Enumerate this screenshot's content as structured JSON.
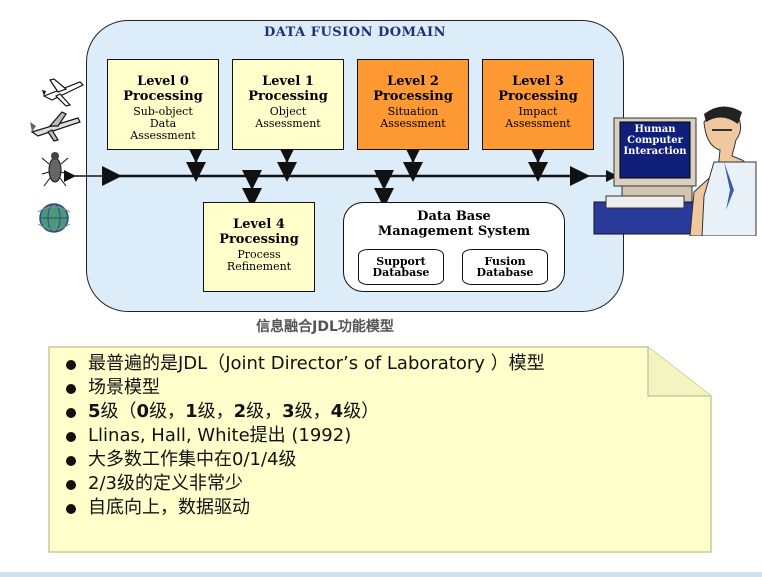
{
  "diagram": {
    "domain_title": "DATA FUSION DOMAIN",
    "level0": {
      "title1": "Level 0",
      "title2": "Processing",
      "sub1": "Sub-object",
      "sub2": "Data",
      "sub3": "Assessment"
    },
    "level1": {
      "title1": "Level 1",
      "title2": "Processing",
      "sub1": "Object",
      "sub2": "Assessment"
    },
    "level2": {
      "title1": "Level 2",
      "title2": "Processing",
      "sub1": "Situation",
      "sub2": "Assessment"
    },
    "level3": {
      "title1": "Level 3",
      "title2": "Processing",
      "sub1": "Impact",
      "sub2": "Assessment"
    },
    "level4": {
      "title1": "Level 4",
      "title2": "Processing",
      "sub1": "Process",
      "sub2": "Refinement"
    },
    "dbms": {
      "title1": "Data Base",
      "title2": "Management System",
      "support1": "Support",
      "support2": "Database",
      "fusion1": "Fusion",
      "fusion2": "Database"
    },
    "hci": {
      "line1": "Human",
      "line2": "Computer",
      "line3": "Interaction"
    },
    "caption": "信息融合JDL功能模型",
    "colors": {
      "domain_bg": "#dcecf8",
      "box_yellow": "#ffffcc",
      "box_orange": "#ff9933",
      "note_bg": "#ffffcc"
    },
    "source_icons": [
      "airplane-icon",
      "fighter-jet-icon",
      "insect-icon",
      "globe-icon"
    ]
  },
  "notes": {
    "b1": "最普遍的是JDL（Joint Director’s of Laboratory ）模型",
    "b2": "场景模型",
    "b3_num5": "5",
    "b3_a": "级（",
    "b3_num0": "0",
    "b3_b": "级，",
    "b3_num1": "1",
    "b3_c": "级，",
    "b3_num2": "2",
    "b3_d": "级，",
    "b3_num3": "3",
    "b3_e": "级，",
    "b3_num4": "4",
    "b3_f": "级）",
    "b4": "Llinas, Hall, White提出 (1992)",
    "b5": "大多数工作集中在0/1/4级",
    "b6": "2/3级的定义非常少",
    "b7": "自底向上，数据驱动"
  }
}
